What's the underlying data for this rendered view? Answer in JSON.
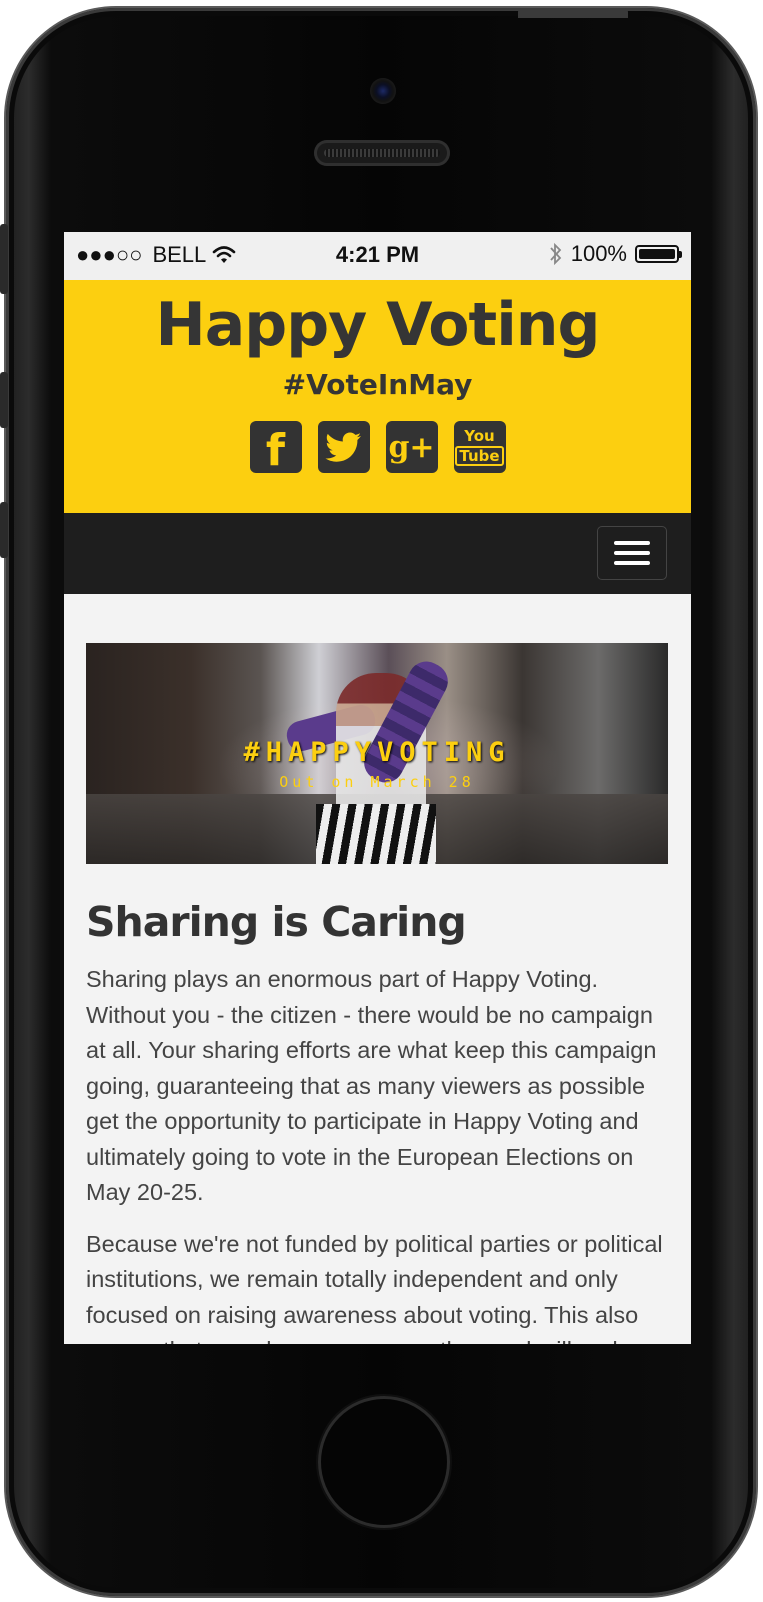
{
  "statusbar": {
    "signal": "●●●○○",
    "carrier": "BELL",
    "time": "4:21 PM",
    "battery": "100%"
  },
  "header": {
    "title": "Happy Voting",
    "hashtag": "#VoteInMay",
    "social": [
      {
        "name": "facebook",
        "glyph": "f"
      },
      {
        "name": "twitter",
        "glyph": "bird"
      },
      {
        "name": "google-plus",
        "glyph": "g+"
      },
      {
        "name": "youtube",
        "glyph_top": "You",
        "glyph_bottom": "Tube"
      }
    ]
  },
  "hero": {
    "title": "#HAPPYVOTING",
    "subtitle": "Out on March 28"
  },
  "main": {
    "heading": "Sharing is Caring",
    "paragraphs": [
      "Sharing plays an enormous part of Happy Voting. Without you - the citizen - there would be no campaign at all. Your sharing efforts are what keep this campaign going, guaranteeing that as many viewers as possible get the opportunity to participate in Happy Voting and ultimately going to vote in the European Elections on May 20-25.",
      "Because we're not funded by political parties or political institutions, we remain totally independent and only focused on raising awareness about voting. This also means that we rely even more on the good-will and support from people like you – so just share away and get the"
    ]
  },
  "colors": {
    "brand_yellow": "#fccf10",
    "nav_dark": "#1e1e1e",
    "text_dark": "#333333"
  }
}
